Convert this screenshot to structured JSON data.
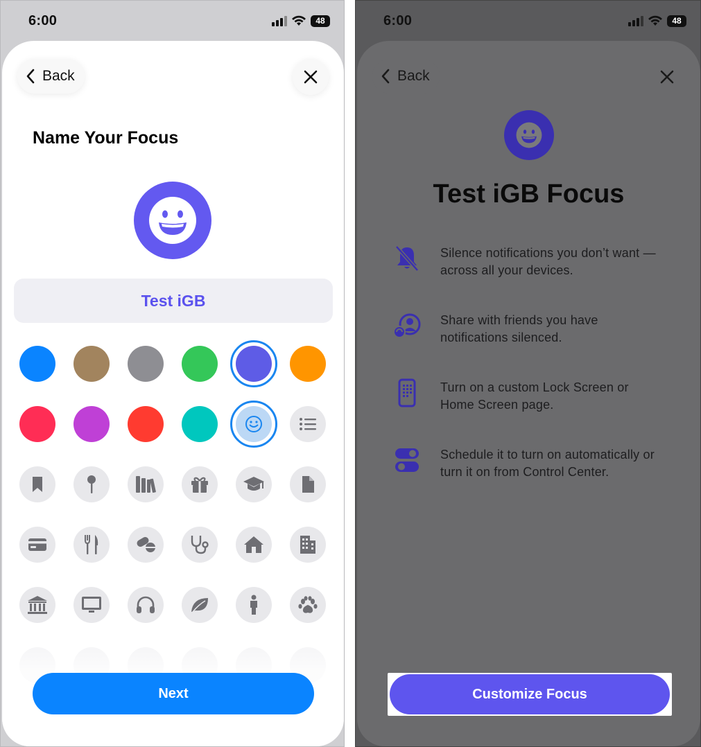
{
  "status_bar": {
    "time": "6:00",
    "battery": "48"
  },
  "left": {
    "back_label": "Back",
    "heading": "Name Your Focus",
    "name_value": "Test iGB",
    "next_label": "Next",
    "colors": [
      "#0a84ff",
      "#a2845e",
      "#8e8e93",
      "#34c759",
      "#5e5ce6",
      "#ff9500",
      "#ff2d55",
      "#bf40d6",
      "#ff3b30",
      "#00c7be"
    ],
    "selected_color": "#5e5ce6",
    "selected_icon": "smiley-icon",
    "icon_rows": [
      [
        "bookmark-icon",
        "pin-icon",
        "books-icon",
        "gift-icon",
        "graduation-cap-icon",
        "document-icon"
      ],
      [
        "credit-card-icon",
        "fork-knife-icon",
        "pills-icon",
        "stethoscope-icon",
        "house-icon",
        "building-icon"
      ],
      [
        "bank-icon",
        "monitor-icon",
        "headphones-icon",
        "leaf-icon",
        "person-icon",
        "paw-icon"
      ]
    ]
  },
  "right": {
    "back_label": "Back",
    "title": "Test iGB Focus",
    "features": [
      {
        "icon": "bell-slash-icon",
        "text": "Silence notifications you don’t want — across all your devices."
      },
      {
        "icon": "share-person-icon",
        "text": "Share with friends you have notifications silenced."
      },
      {
        "icon": "phone-grid-icon",
        "text": "Turn on a custom Lock Screen or Home Screen page."
      },
      {
        "icon": "toggles-icon",
        "text": "Schedule it to turn on automatically or turn it on from Control Center."
      }
    ],
    "cta_label": "Customize Focus"
  }
}
